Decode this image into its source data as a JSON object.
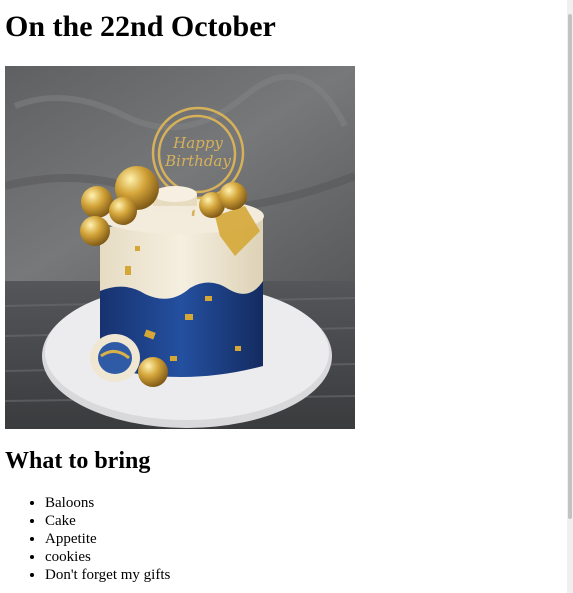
{
  "page": {
    "title": "On the 22nd October",
    "image_alt": "Blue and gold birthday cake with Happy Birthday topper",
    "topper_text": "Happy Birthday",
    "section_heading": "What to bring",
    "bring_list": [
      "Baloons",
      "Cake",
      "Appetite",
      "cookies",
      "Don't forget my gifts"
    ]
  },
  "colors": {
    "wall": "#6e6f71",
    "table": "#4a4b4d",
    "plate": "#e9e9ec",
    "cream": "#efe8d6",
    "navy": "#1f3f86",
    "gold": "#c99b2e"
  }
}
